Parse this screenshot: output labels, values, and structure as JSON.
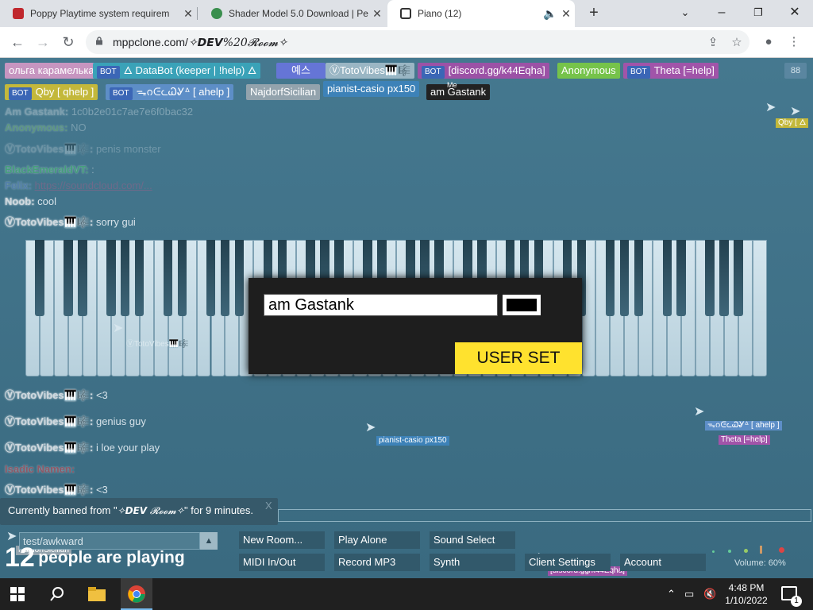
{
  "browser": {
    "tabs": [
      {
        "title": "Poppy Playtime system requirem",
        "favicon_color": "#c0272d"
      },
      {
        "title": "Shader Model 5.0 Download | Pe",
        "favicon_color": "#3a8f4e"
      },
      {
        "title": "Piano (12)",
        "favicon_color": "#333333"
      }
    ],
    "url_host": "mppclone.com/",
    "url_room": "✧𝘿𝙀𝙑%20𝓡𝓸𝓸𝓶✧"
  },
  "top_users": [
    {
      "label": "ольга карамелька",
      "bot": false,
      "color": "#c795c0"
    },
    {
      "label": "🜂 DataBot (keeper | !help) 🜂",
      "bot": true,
      "color": "#3aa2b8"
    },
    {
      "label": "예스",
      "bot": false,
      "color": "#6575d6"
    },
    {
      "label": "ⓋTotoVibes🎹🎼",
      "bot": false,
      "color": "#9ab6c4"
    },
    {
      "label": "[discord.gg/k44Eqha]",
      "bot": true,
      "color": "#9c52a6"
    },
    {
      "label": "Anonymous",
      "bot": false,
      "color": "#76c34a"
    },
    {
      "label": "Theta [=help]",
      "bot": true,
      "color": "#a154a9"
    },
    {
      "label": "Qby [ qhelp ]",
      "bot": true,
      "color": "#c3b83b"
    },
    {
      "label": "ᯓᨣᕮᓚᏇᎽᐞ [ ahelp ]",
      "bot": true,
      "color": "#5d8ec7"
    },
    {
      "label": "NajdorfSicilian",
      "bot": false,
      "color": "#93a3ad"
    },
    {
      "label": "pianist-casio px150",
      "bot": false,
      "color": "#3d82b8"
    },
    {
      "label": "am Gastank",
      "bot": false,
      "color": "#222222"
    }
  ],
  "me_label": "Me",
  "settings_button": "88",
  "chat": [
    {
      "name": "Am Gastank:",
      "text": "1c0b2e01c7ae7e6f0bac32"
    },
    {
      "name": "Anonymous:",
      "text": "NO"
    },
    {
      "name": "ⓋTotoVibes🎹🎼:",
      "text": "penis monster"
    },
    {
      "name": "BlackEmeraldVT:",
      "text": ":"
    },
    {
      "name": "Felix:",
      "text": "https://soundcloud.com/..."
    },
    {
      "name": "Noob:",
      "text": "cool"
    },
    {
      "name": "ⓋTotoVibes🎹🎼:",
      "text": "sorry gui"
    },
    {
      "name": "ⓋTotoVibes🎹🎼:",
      "text": "<3"
    },
    {
      "name": "ⓋTotoVibes🎹🎼:",
      "text": "genius guy"
    },
    {
      "name": "ⓋTotoVibes🎹🎼:",
      "text": "i loe your play"
    },
    {
      "name": "Isadic Namen:",
      "text": ""
    },
    {
      "name": "ⓋTotoVibes🎹🎼:",
      "text": "<3"
    }
  ],
  "modal": {
    "name_value": "am Gastank",
    "color_value": "#000000",
    "submit_label": "USER SET"
  },
  "banned": {
    "prefix": "Currently banned from \"",
    "room": "✧𝘿𝙀𝙑 𝓡𝓸𝓸𝓶✧",
    "suffix": "\" for 9 minutes.",
    "close": "X"
  },
  "chat_input": {
    "value": "test/awkward"
  },
  "people_count": {
    "number": "12",
    "text": "people are playing"
  },
  "menu": {
    "new_room": "New Room...",
    "play_alone": "Play Alone",
    "sound_select": "Sound Select",
    "midi": "MIDI In/Out",
    "record": "Record MP3",
    "synth": "Synth",
    "client_settings": "Client Settings",
    "account": "Account"
  },
  "volume": "Volume: 60%",
  "cursor_tags": {
    "toto": "ⓋTotoVibes🎹🎼",
    "pianist": "pianist-casio px150",
    "ahelp": "ᯓᨣᕮᓚᏇᎽᐞ [ ahelp ]",
    "theta": "Theta [=help]",
    "discord": "[discord.gg/k44Eqha]",
    "najdorf": "NajdorfSicilian",
    "qby": "Qby [ 🜂"
  },
  "taskbar": {
    "time": "4:48 PM",
    "date": "1/10/2022",
    "notifications": "1"
  }
}
